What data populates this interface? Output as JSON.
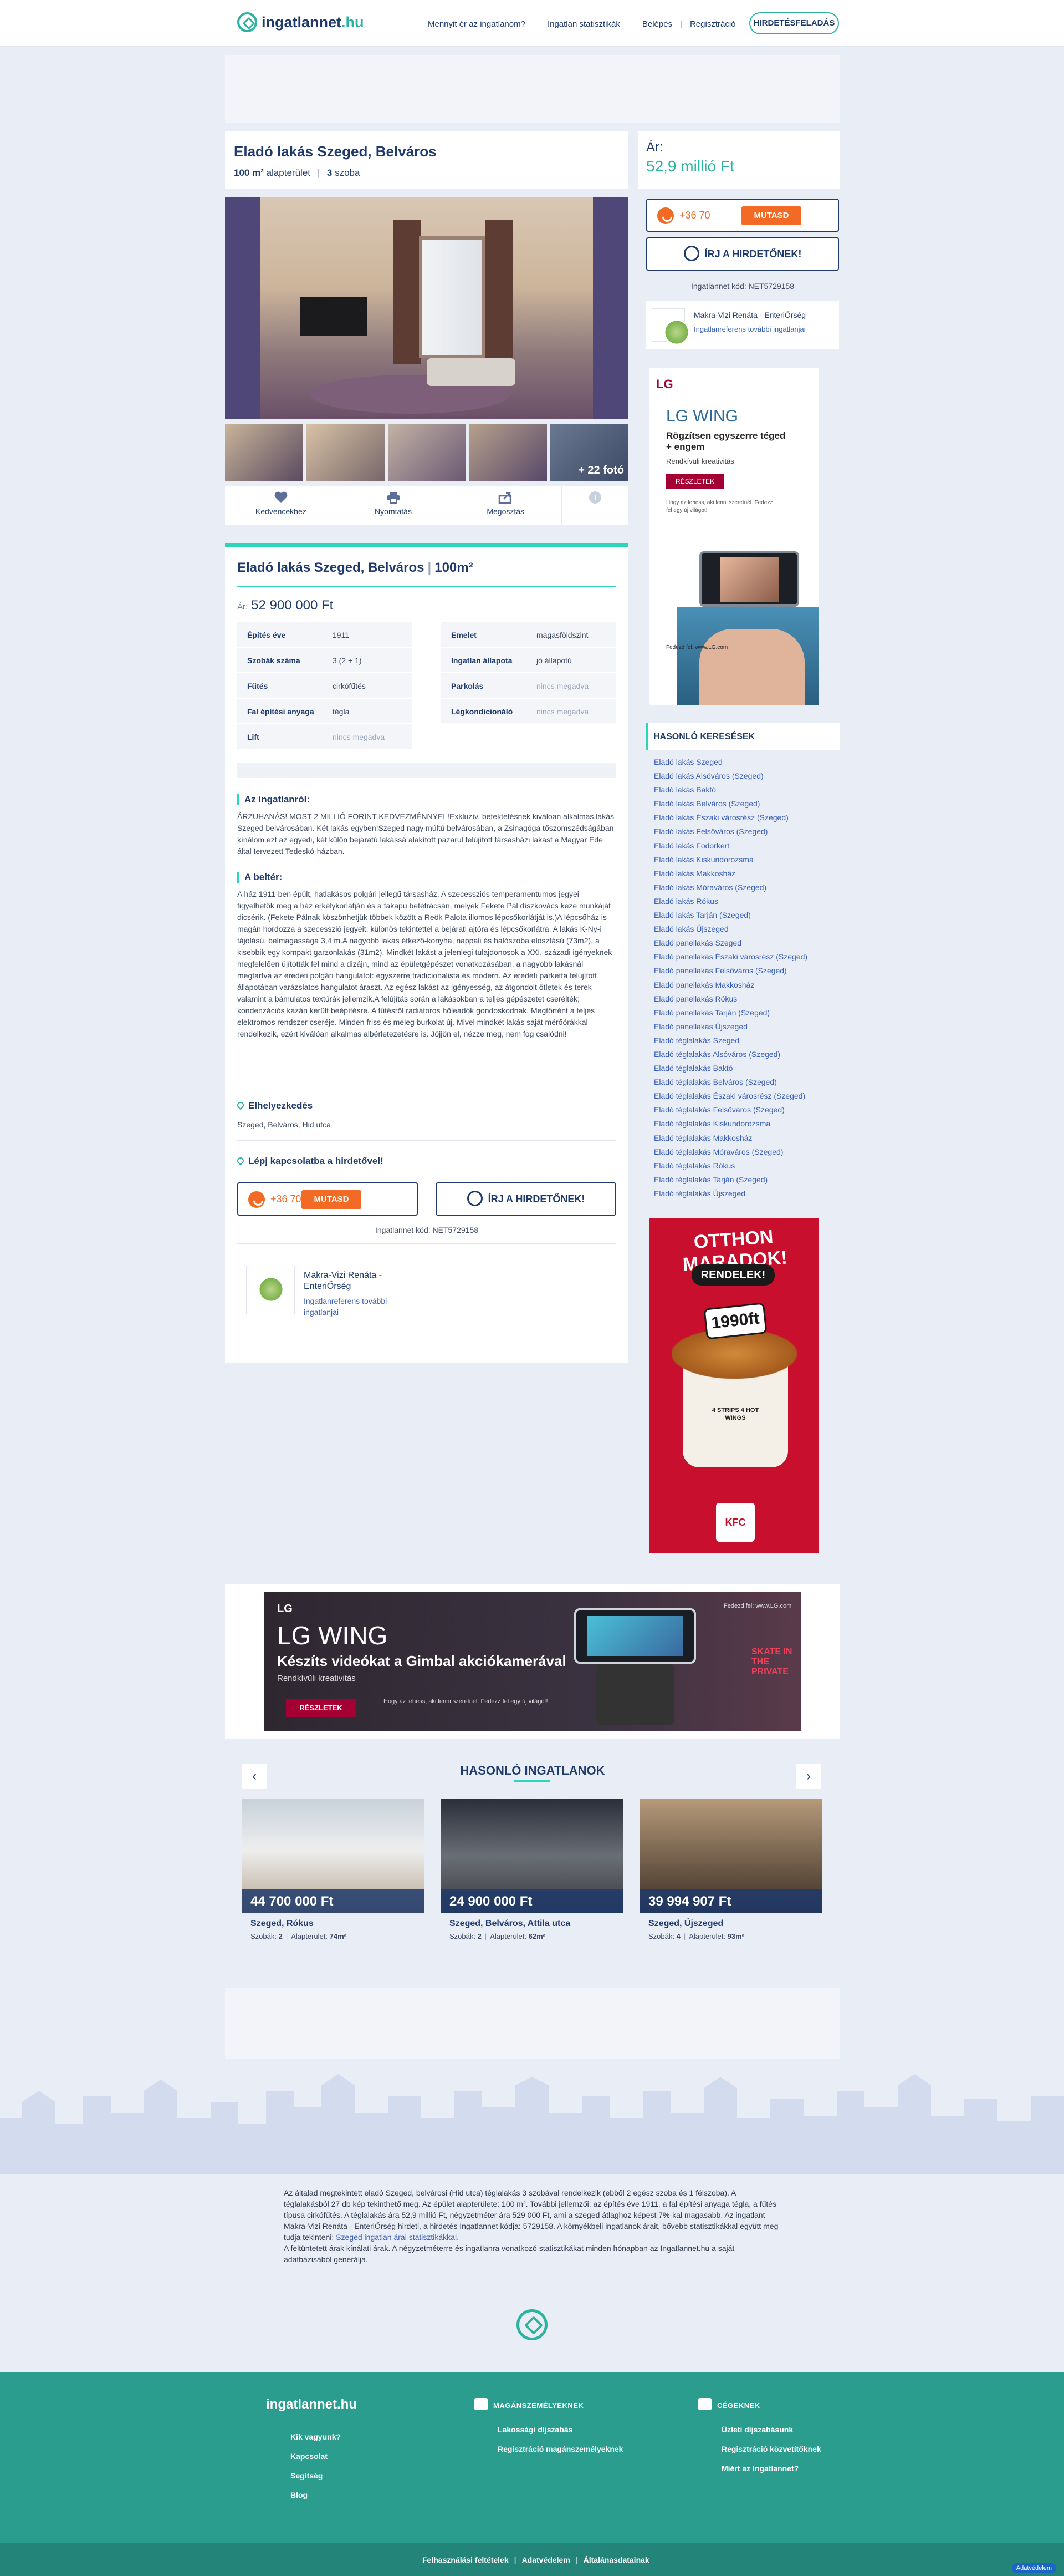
{
  "header": {
    "logo_main": "ingatlannet",
    "logo_tld": ".hu",
    "nav": [
      "Mennyit ér az ingatlanom?",
      "Ingatlan statisztikák",
      "Belépés",
      "Regisztráció"
    ],
    "post_button": "HIRDETÉSFELADÁS"
  },
  "listing": {
    "title": "Eladó lakás Szeged, Belváros",
    "area": "100 m²",
    "area_label": "alapterület",
    "rooms": "3",
    "rooms_label": "szoba",
    "price_label": "Ár:",
    "price_short": "52,9 millió Ft",
    "price_full": "52 900 000 Ft",
    "detail_title": "Eladó lakás Szeged, Belváros",
    "detail_area": "100m²",
    "more_photos": "+ 22 fotó",
    "code": "Ingatlannet kód: NET5729158"
  },
  "actions": [
    "Kedvencekhez",
    "Nyomtatás",
    "Megosztás"
  ],
  "contact": {
    "phone": "+36 70",
    "show": "MUTASD",
    "write": "ÍRJ A HIRDETŐNEK!",
    "agent_name": "Makra-Vizi Renáta - EnteriŐrség",
    "agent_link": "Ingatlanreferens további ingatlanjai",
    "agent_name_l1": "Makra-Vizi Renáta -",
    "agent_name_l2": "EnteriŐrség",
    "agent_link_l1": "Ingatlanreferens további",
    "agent_link_l2": "ingatlanjai",
    "cta": "Lépj kapcsolatba a hirdetővel!"
  },
  "facts": [
    {
      "k": "Építés éve",
      "v": "1911"
    },
    {
      "k": "Emelet",
      "v": "magasföldszint"
    },
    {
      "k": "Szobák száma",
      "v": "3 (2 + 1)"
    },
    {
      "k": "Ingatlan állapota",
      "v": "jó állapotú"
    },
    {
      "k": "Fűtés",
      "v": "cirkófűtés"
    },
    {
      "k": "Parkolás",
      "v": "nincs megadva"
    },
    {
      "k": "Fal építési anyaga",
      "v": "tégla"
    },
    {
      "k": "Légkondicionáló",
      "v": "nincs megadva"
    },
    {
      "k": "Lift",
      "v": "nincs megadva"
    }
  ],
  "description": {
    "h1": "Az ingatlanról:",
    "p1": "ÁRZUHANÁS! MOST 2 MILLIÓ FORINT KEDVEZMÉNNYEL!Exkluzív, befektetésnek kiválóan alkalmas lakás Szeged belvárosában. Két lakás egyben!Szeged nagy múltú belvárosában, a Zsinagóga tőszomszédságában kínálom ezt az egyedi, két külön bejáratú lakássá alakított pazarul felújított társasházi lakást a Magyar Ede által tervezett Tedeskó-házban.",
    "h2": "A beltér:",
    "p2": "A ház 1911-ben épült, hatlakásos polgári jellegű társasház. A szecessziós temperamentumos jegyei figyelhetők meg a ház erkélykorlátján és a fakapu betétrácsán, melyek Fekete Pál díszkovács keze munkáját dicsérik. (Fekete Pálnak köszönhetjük többek között a Reök Palota illomos lépcsőkorlátját is.)A lépcsőház is magán hordozza a szecesszió jegyeit, különös tekintettel a bejárati ajtóra és lépcsőkorlátra. A lakás K-Ny-i tájolású, belmagassága 3,4 m.A nagyobb lakás étkező-konyha, nappali és hálószoba elosztású (73m2), a kisebbik egy kompakt garzonlakás (31m2). Mindkét lakást a jelenlegi tulajdonosok a XXI. századi igényeknek megfelelően újították fel mind a dizájn, mind az épületgépészet vonatkozásában, a nagyobb lakásnál megtartva az eredeti polgári hangulatot: egyszerre tradicionalista és modern. Az eredeti parketta felújított állapotában varázslatos hangulatot áraszt. Az egész lakást az igényesség, az átgondolt ötletek és terek valamint a bámulatos textúrák jellemzik.A felújítás során a lakásokban a teljes gépészetet cserélték; kondenzációs kazán került beépítésre. A fűtésről radiátoros hőleadók gondoskodnak. Megtörtént a teljes elektromos rendszer cseréje. Minden friss és meleg burkolat új. Mivel mindkét lakás saját mérőórákkal rendelkezik, ezért kiválóan alkalmas albérletezetésre is. Jöjjön el, nézze meg, nem fog csalódni!",
    "loc_title": "Elhelyezkedés",
    "loc_value": "Szeged, Belváros, Hid utca"
  },
  "similar_searches": {
    "title": "HASONLÓ KERESÉSEK",
    "items": [
      "Eladó lakás Szeged",
      "Eladó lakás Alsóváros (Szeged)",
      "Eladó lakás Baktó",
      "Eladó lakás Belváros (Szeged)",
      "Eladó lakás Északi városrész (Szeged)",
      "Eladó lakás Felsőváros (Szeged)",
      "Eladó lakás Fodorkert",
      "Eladó lakás Kiskundorozsma",
      "Eladó lakás Makkosház",
      "Eladó lakás Móraváros (Szeged)",
      "Eladó lakás Rókus",
      "Eladó lakás Tarján (Szeged)",
      "Eladó lakás Újszeged",
      "Eladó panellakás Szeged",
      "Eladó panellakás Északi városrész (Szeged)",
      "Eladó panellakás Felsőváros (Szeged)",
      "Eladó panellakás Makkosház",
      "Eladó panellakás Rókus",
      "Eladó panellakás Tarján (Szeged)",
      "Eladó panellakás Újszeged",
      "Eladó téglalakás Szeged",
      "Eladó téglalakás Alsóváros (Szeged)",
      "Eladó téglalakás Baktó",
      "Eladó téglalakás Belváros (Szeged)",
      "Eladó téglalakás Északi városrész (Szeged)",
      "Eladó téglalakás Felsőváros (Szeged)",
      "Eladó téglalakás Kiskundorozsma",
      "Eladó téglalakás Makkosház",
      "Eladó téglalakás Móraváros (Szeged)",
      "Eladó téglalakás Rókus",
      "Eladó téglalakás Tarján (Szeged)",
      "Eladó téglalakás Újszeged"
    ]
  },
  "ad_lg_side": {
    "brand": "LG",
    "product": "LG WING",
    "headline": "Rögzítsen egyszerre téged + engem",
    "sub": "Rendkívüli kreativitás",
    "button": "RÉSZLETEK",
    "fine": "Hogy az lehess, aki lenni szeretnél. Fedezz fel egy új világot!",
    "url": "Fedezd fel: www.LG.com"
  },
  "ad_kfc": {
    "h1": "OTTHON MARADOK!",
    "h2": "RENDELEK!",
    "price": "1990ft",
    "bucket": "4 STRIPS 4 HOT WINGS",
    "brand": "KFC"
  },
  "ad_lg_big": {
    "brand": "LG",
    "product": "LG WING",
    "headline": "Készíts videókat a Gimbal akciókamerával",
    "sub": "Rendkívüli kreativitás",
    "button": "RÉSZLETEK",
    "fine": "Hogy az lehess, aki lenni szeretnél. Fedezz fel egy új világot!",
    "url": "Fedezd fel: www.LG.com",
    "side_text": "SKATE IN THE PRIVATE"
  },
  "similar": {
    "title": "HASONLÓ INGATLANOK",
    "prev": "‹",
    "next": "›",
    "cards": [
      {
        "price": "44 700 000 Ft",
        "loc": "Szeged, Rókus",
        "rooms_k": "Szobák:",
        "rooms": "2",
        "area_k": "Alapterület:",
        "area": "74m²"
      },
      {
        "price": "24 900 000 Ft",
        "loc": "Szeged, Belváros, Attila utca",
        "rooms_k": "Szobák:",
        "rooms": "2",
        "area_k": "Alapterület:",
        "area": "62m²"
      },
      {
        "price": "39 994 907 Ft",
        "loc": "Szeged, Újszeged",
        "rooms_k": "Szobák:",
        "rooms": "4",
        "area_k": "Alapterület:",
        "area": "93m²"
      }
    ]
  },
  "seo": {
    "text1": "Az általad megtekintett eladó Szeged, belvárosi (Hid utca) téglalakás 3 szobával rendelkezik (ebből 2 egész szoba és 1 félszoba). A téglalakásból 27 db kép tekinthető meg. Az épület alapterülete: 100 m². További jellemzői: az építés éve 1911, a fal építési anyaga tégla, a fűtés típusa cirkófűtés. A téglalakás ára 52,9 millió Ft, négyzetméter ára 529 000 Ft, ami a szeged átlaghoz képest 7%-kal magasabb. Az ingatlant Makra-Vizi Renáta - EnteriŐrség hirdeti, a hirdetés Ingatlannet kódja: 5729158. A környékbeli ingatlanok árait, bővebb statisztikákkal együtt meg tudja tekinteni: ",
    "link": "Szeged ingatlan árai statisztikákkal.",
    "text2": "A feltüntetett árak kínálati árak. A négyzetméterre és ingatlanra vonatkozó statisztikákat minden hónapban az Ingatlannet.hu a saját adatbázisából generálja."
  },
  "footer": {
    "logo": "ingatlannet.hu",
    "col1": [
      "Kik vagyunk?",
      "Kapcsolat",
      "Segítség",
      "Blog"
    ],
    "col2_title": "MAGÁNSZEMÉLYEKNEK",
    "col2": [
      "Lakossági díjszabás",
      "Regisztráció magánszemélyeknek"
    ],
    "col3_title": "CÉGEKNEK",
    "col3": [
      "Üzleti díjszabásunk",
      "Regisztráció közvetítőknek",
      "Miért az Ingatlannet?"
    ],
    "bottom": [
      "Felhasználási feltételek",
      "Adatvédelem",
      "Általánasdatainak"
    ],
    "privacy": "Adatvédelem"
  }
}
